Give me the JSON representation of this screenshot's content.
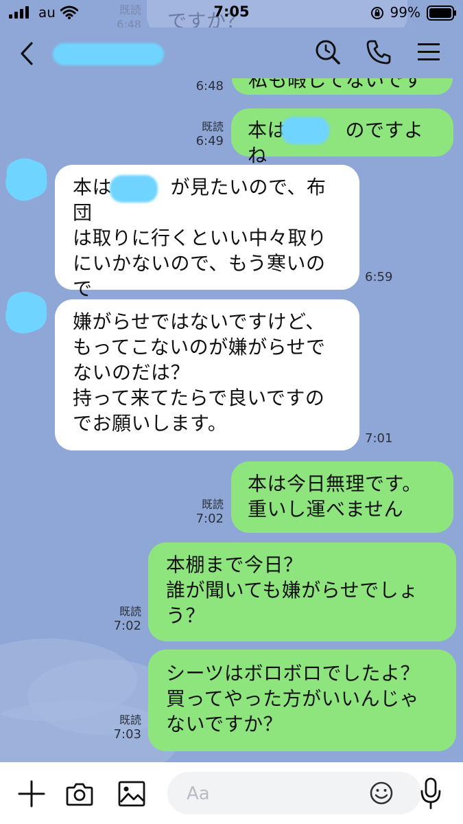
{
  "status_bar": {
    "carrier": "au",
    "time": "7:05",
    "battery": "99%"
  },
  "header": {
    "icons": [
      "back-chevron-icon",
      "search-icon",
      "phone-icon",
      "menu-icon"
    ]
  },
  "messages": [
    {
      "side": "out",
      "text": "私も暇してないです",
      "read": "既読",
      "time": "6:48"
    },
    {
      "side": "out",
      "text": "本は　　　のですよね",
      "read": "既読",
      "time": "6:49"
    },
    {
      "side": "in",
      "lines": [
        "本は　　　が見たいので、布団",
        "は取りに行くといい中々取り",
        "にいかないので、もう寒いの",
        "で"
      ],
      "time": "6:59"
    },
    {
      "side": "in",
      "lines": [
        "嫌がらせではないですけど、",
        "もってこないのが嫌がらせで",
        "ないのだは？",
        "持って来てたらで良いですの",
        "でお願いします。"
      ],
      "time": "7:01"
    },
    {
      "side": "out",
      "lines": [
        "本は今日無理です。",
        "重いし運べません"
      ],
      "read": "既読",
      "time": "7:02"
    },
    {
      "side": "out",
      "lines": [
        "本棚まで今日？",
        "誰が聞いても嫌がらせでしょ",
        "う？"
      ],
      "read": "既読",
      "time": "7:02"
    },
    {
      "side": "out",
      "lines": [
        "シーツはボロボロでしたよ？",
        "買ってやった方がいいんじゃ",
        "ないですか？"
      ],
      "read": "既読",
      "time": "7:03"
    }
  ],
  "ghost": {
    "lines": [
      "ですか？"
    ],
    "read": "既読",
    "time": "6:48"
  },
  "composer": {
    "placeholder": "Aa",
    "icons": [
      "plus-icon",
      "camera-icon",
      "image-icon",
      "emoji-icon",
      "microphone-icon"
    ]
  },
  "colors": {
    "background": "#8fa7d6",
    "sent_bubble": "#8ee57e",
    "received_bubble": "#ffffff",
    "redaction": "#6fd4ff"
  }
}
